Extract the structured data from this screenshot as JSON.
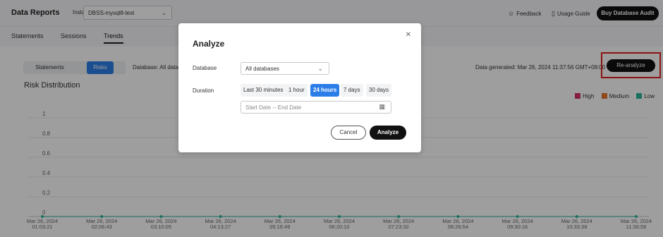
{
  "header": {
    "title": "Data Reports",
    "instance_label": "Instance",
    "instance_value": "DBSS-mysql8-test",
    "feedback": "Feedback",
    "usage_guide": "Usage Guide",
    "buy_button": "Buy Database Audit"
  },
  "tabs": [
    {
      "label": "Statements",
      "active": false
    },
    {
      "label": "Sessions",
      "active": false
    },
    {
      "label": "Trends",
      "active": true
    }
  ],
  "toolbar": {
    "segments": [
      {
        "label": "Statements",
        "active": false
      },
      {
        "label": "Risks",
        "active": true
      }
    ],
    "database_label": "Database: All databa",
    "data_generated": "Data generated: Mar 26, 2024 11:37:56 GMT+08:00",
    "reanalyze_button": "Re-analyze"
  },
  "chart_data": {
    "type": "line",
    "title": "Risk Distribution",
    "x": [
      "Mar 26, 2024 01:03:21",
      "Mar 26, 2024 02:06:43",
      "Mar 26, 2024 03:10:05",
      "Mar 26, 2024 04:13:27",
      "Mar 26, 2024 05:16:49",
      "Mar 26, 2024 06:20:10",
      "Mar 26, 2024 07:23:32",
      "Mar 26, 2024 08:26:54",
      "Mar 26, 2024 09:30:16",
      "Mar 26, 2024 10:33:38",
      "Mar 26, 2024 11:36:59"
    ],
    "x_date": [
      "Mar 26, 2024",
      "Mar 26, 2024",
      "Mar 26, 2024",
      "Mar 26, 2024",
      "Mar 26, 2024",
      "Mar 26, 2024",
      "Mar 26, 2024",
      "Mar 26, 2024",
      "Mar 26, 2024",
      "Mar 26, 2024",
      "Mar 26, 2024"
    ],
    "x_time": [
      "01:03:21",
      "02:06:43",
      "03:10:05",
      "04:13:27",
      "05:16:49",
      "06:20:10",
      "07:23:32",
      "08:26:54",
      "09:30:16",
      "10:33:38",
      "11:36:59"
    ],
    "yticks": [
      "1",
      "0.8",
      "0.6",
      "0.4",
      "0.2",
      "0"
    ],
    "ylim": [
      0,
      1
    ],
    "series": [
      {
        "name": "High",
        "color": "#d6336c",
        "values": [
          0,
          0,
          0,
          0,
          0,
          0,
          0,
          0,
          0,
          0,
          0
        ]
      },
      {
        "name": "Medium",
        "color": "#e8772e",
        "values": [
          0,
          0,
          0,
          0,
          0,
          0,
          0,
          0,
          0,
          0,
          0
        ]
      },
      {
        "name": "Low",
        "color": "#2bb39a",
        "values": [
          0,
          0,
          0,
          0,
          0,
          0,
          0,
          0,
          0,
          0,
          0
        ]
      }
    ],
    "legend": "top-right",
    "grid": true
  },
  "modal": {
    "title": "Analyze",
    "database_label": "Database",
    "database_value": "All databases",
    "duration_label": "Duration",
    "durations": [
      {
        "label": "Last 30 minutes",
        "active": false
      },
      {
        "label": "1 hour",
        "active": false
      },
      {
        "label": "24 hours",
        "active": true
      },
      {
        "label": "7 days",
        "active": false
      },
      {
        "label": "30 days",
        "active": false
      }
    ],
    "date_placeholder": "Start Date -- End Date",
    "cancel_button": "Cancel",
    "analyze_button": "Analyze"
  }
}
